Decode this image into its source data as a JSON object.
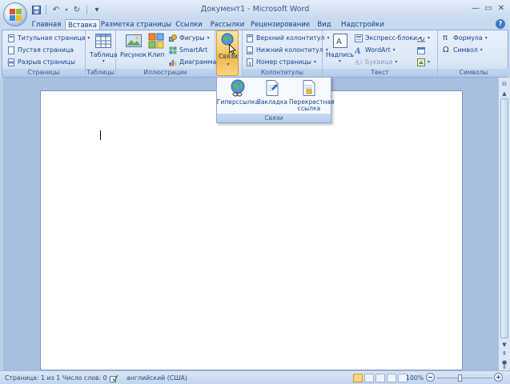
{
  "window": {
    "title": "Документ1 - Microsoft Word",
    "controls": {
      "minimize": "—",
      "maximize": "▭",
      "close": "✕"
    }
  },
  "quick_access": [
    {
      "icon": "save-icon",
      "glyph": "💾"
    },
    {
      "icon": "undo-icon",
      "glyph": "↶"
    },
    {
      "icon": "redo-icon",
      "glyph": "↻"
    },
    {
      "icon": "customize-icon",
      "glyph": "▾"
    }
  ],
  "tabs": [
    "Главная",
    "Вставка",
    "Разметка страницы",
    "Ссылки",
    "Рассылки",
    "Рецензирование",
    "Вид",
    "Надстройки"
  ],
  "active_tab": "Вставка",
  "ribbon": {
    "pages": {
      "label": "Страницы",
      "items": [
        "Титульная страница",
        "Пустая страница",
        "Разрыв страницы"
      ]
    },
    "tables": {
      "label": "Таблицы",
      "table": "Таблица"
    },
    "illustrations": {
      "label": "Иллюстрации",
      "picture": "Рисунок",
      "clip": "Клип",
      "shapes": "Фигуры",
      "smartart": "SmartArt",
      "chart": "Диаграмма"
    },
    "links": {
      "label": "Связи"
    },
    "header_footer": {
      "label": "Колонтитулы",
      "items": [
        "Верхний колонтитул",
        "Нижний колонтитул",
        "Номер страницы"
      ]
    },
    "text": {
      "label": "Текст",
      "textbox": "Надпись",
      "quick_parts": "Экспресс-блоки",
      "wordart": "WordArt",
      "dropcap": "Буквица"
    },
    "symbols": {
      "label": "Символы",
      "equation": "Формула",
      "symbol": "Символ"
    }
  },
  "links_dropdown": {
    "label": "Связи",
    "items": [
      "Гиперссылка",
      "Закладка",
      "Перекрестная ссылка"
    ]
  },
  "status": {
    "page": "Страница: 1 из 1",
    "words": "Число слов: 0",
    "language": "английский (США)",
    "zoom": "100%"
  },
  "colors": {
    "ribbon_bg": "#dbe7f7",
    "accent_highlight": "#f7c85e",
    "text": "#15428b"
  }
}
